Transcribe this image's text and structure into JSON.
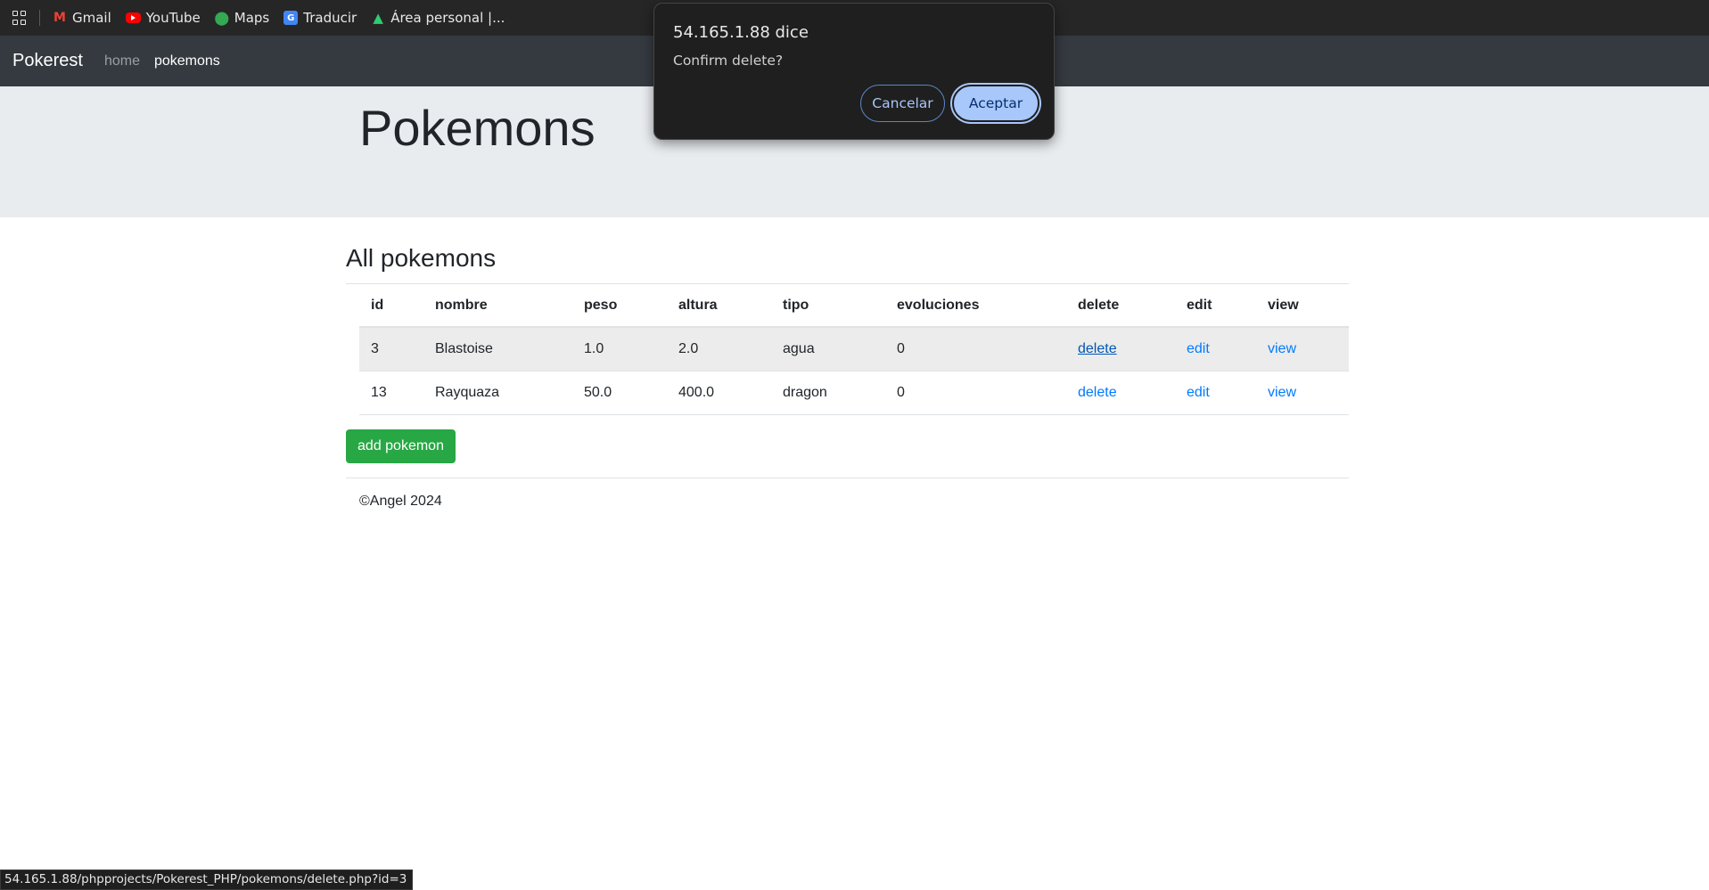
{
  "bookmarks": [
    {
      "label": "Gmail",
      "icon": "gmail-icon"
    },
    {
      "label": "YouTube",
      "icon": "youtube-icon"
    },
    {
      "label": "Maps",
      "icon": "maps-icon"
    },
    {
      "label": "Traducir",
      "icon": "translate-icon"
    },
    {
      "label": "Área personal |...",
      "icon": "area-personal-icon"
    }
  ],
  "navbar": {
    "brand": "Pokerest",
    "links": [
      {
        "label": "home",
        "active": false
      },
      {
        "label": "pokemons",
        "active": true
      }
    ]
  },
  "jumbotron": {
    "title": "Pokemons"
  },
  "main": {
    "title": "All pokemons",
    "table": {
      "headers": [
        "id",
        "nombre",
        "peso",
        "altura",
        "tipo",
        "evoluciones",
        "delete",
        "edit",
        "view"
      ],
      "rows": [
        {
          "id": "3",
          "nombre": "Blastoise",
          "peso": "1.0",
          "altura": "2.0",
          "tipo": "agua",
          "evoluciones": "0",
          "delete": "delete",
          "edit": "edit",
          "view": "view"
        },
        {
          "id": "13",
          "nombre": "Rayquaza",
          "peso": "50.0",
          "altura": "400.0",
          "tipo": "dragon",
          "evoluciones": "0",
          "delete": "delete",
          "edit": "edit",
          "view": "view"
        }
      ]
    },
    "add_button": "add pokemon"
  },
  "footer": {
    "text": "©Angel 2024"
  },
  "status_url": "54.165.1.88/phpprojects/Pokerest_PHP/pokemons/delete.php?id=3",
  "dialog": {
    "title": "54.165.1.88 dice",
    "message": "Confirm delete?",
    "cancel_label": "Cancelar",
    "accept_label": "Aceptar"
  },
  "colors": {
    "navbar_bg": "#343a40",
    "jumbotron_bg": "#e9ecef",
    "link": "#007bff",
    "success": "#28a745",
    "dialog_accent": "#a8c7fa"
  }
}
